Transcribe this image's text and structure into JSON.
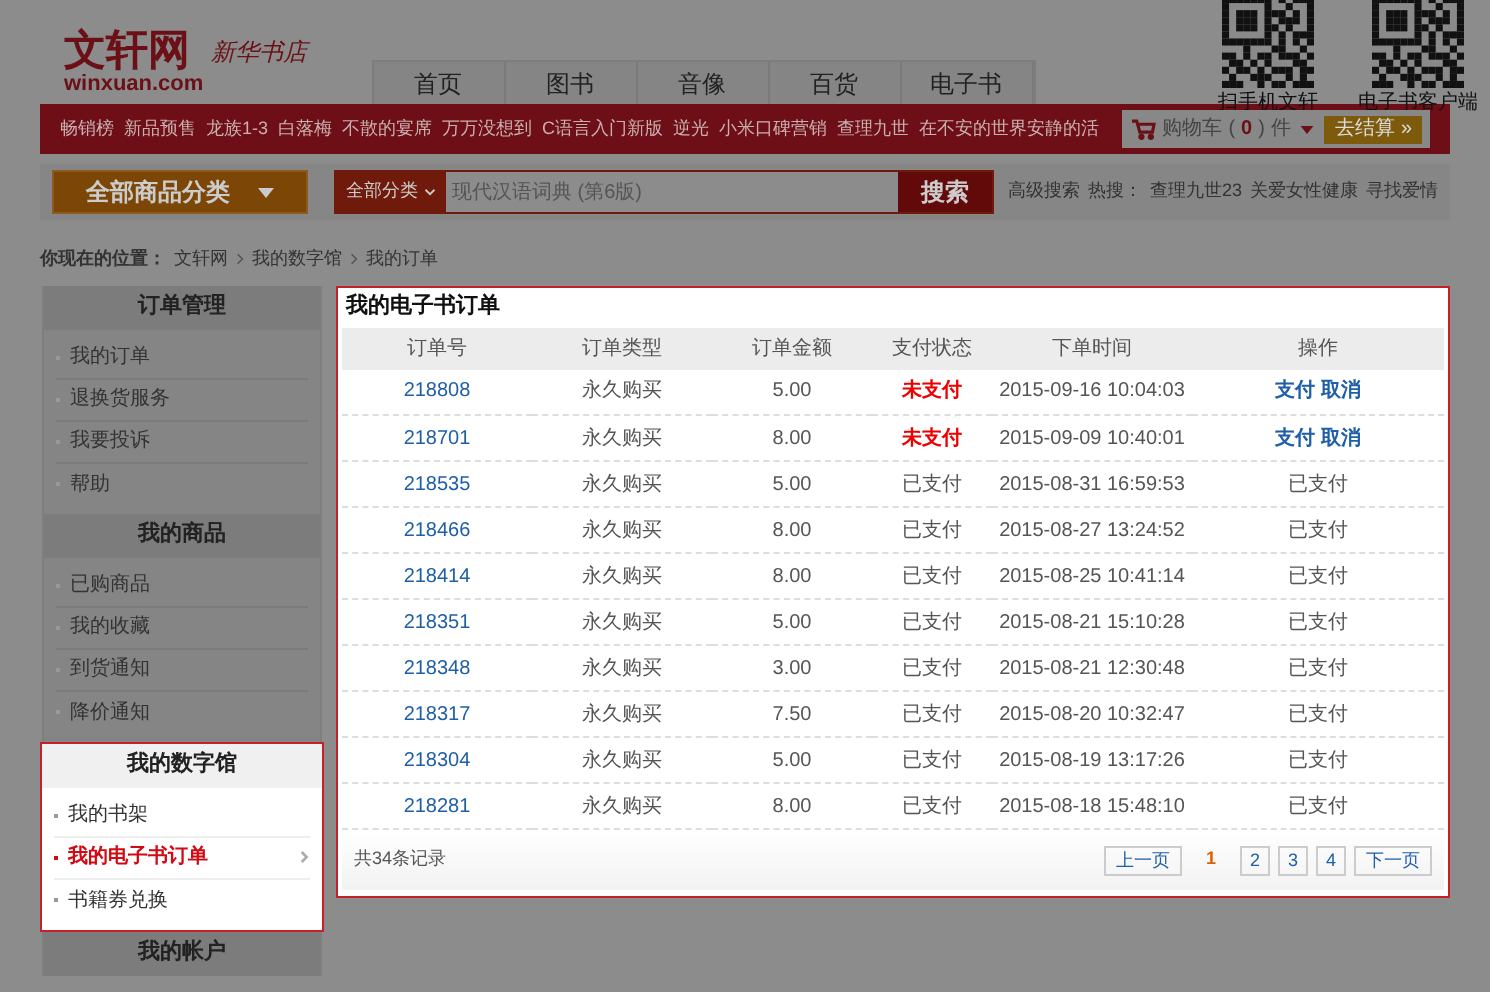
{
  "logo": {
    "name": "文轩网",
    "domain": "winxuan.com",
    "slogan": "新华书店"
  },
  "nav": [
    {
      "label": "首页"
    },
    {
      "label": "图书"
    },
    {
      "label": "音像"
    },
    {
      "label": "百货"
    },
    {
      "label": "电子书"
    }
  ],
  "qr_codes": [
    {
      "caption": "扫手机文轩"
    },
    {
      "caption": "电子书客户端"
    }
  ],
  "promo_links": [
    "畅销榜",
    "新品预售",
    "龙族1-3",
    "白落梅",
    "不散的宴席",
    "万万没想到",
    "C语言入门新版",
    "逆光",
    "小米口碑营销",
    "查理九世",
    "在不安的世界安静的活"
  ],
  "cart": {
    "label": "购物车",
    "open": "(",
    "count": "0",
    "close": ")",
    "unit": "件",
    "checkout": "去结算",
    "checkout_arrows": "»"
  },
  "category_button": "全部商品分类",
  "search": {
    "scope": "全部分类",
    "placeholder": "现代汉语词典 (第6版)",
    "button": "搜索",
    "advanced": "高级搜索",
    "hot_label": "热搜：",
    "hot": [
      "查理九世23",
      "关爱女性健康",
      "寻找爱情"
    ]
  },
  "breadcrumb": {
    "label": "你现在的位置：",
    "items": [
      "文轩网",
      "我的数字馆",
      "我的订单"
    ]
  },
  "sidebar": [
    {
      "title": "订单管理",
      "highlighted": false,
      "items": [
        {
          "label": "我的订单",
          "selected": false
        },
        {
          "label": "退换货服务",
          "selected": false
        },
        {
          "label": "我要投诉",
          "selected": false
        },
        {
          "label": "帮助",
          "selected": false
        }
      ]
    },
    {
      "title": "我的商品",
      "highlighted": false,
      "items": [
        {
          "label": "已购商品",
          "selected": false
        },
        {
          "label": "我的收藏",
          "selected": false
        },
        {
          "label": "到货通知",
          "selected": false
        },
        {
          "label": "降价通知",
          "selected": false
        }
      ]
    },
    {
      "title": "我的数字馆",
      "highlighted": true,
      "items": [
        {
          "label": "我的书架",
          "selected": false
        },
        {
          "label": "我的电子书订单",
          "selected": true
        },
        {
          "label": "书籍券兑换",
          "selected": false
        }
      ]
    },
    {
      "title": "我的帐户",
      "highlighted": false
    }
  ],
  "orders": {
    "title": "我的电子书订单",
    "columns": [
      "订单号",
      "订单类型",
      "订单金额",
      "支付状态",
      "下单时间",
      "操作"
    ],
    "rows": [
      {
        "id": "218808",
        "type": "永久购买",
        "amount": "5.00",
        "status": "未支付",
        "paid": false,
        "time": "2015-09-16 10:04:03",
        "actions": [
          "支付",
          "取消"
        ]
      },
      {
        "id": "218701",
        "type": "永久购买",
        "amount": "8.00",
        "status": "未支付",
        "paid": false,
        "time": "2015-09-09 10:40:01",
        "actions": [
          "支付",
          "取消"
        ]
      },
      {
        "id": "218535",
        "type": "永久购买",
        "amount": "5.00",
        "status": "已支付",
        "paid": true,
        "time": "2015-08-31 16:59:53",
        "action_text": "已支付"
      },
      {
        "id": "218466",
        "type": "永久购买",
        "amount": "8.00",
        "status": "已支付",
        "paid": true,
        "time": "2015-08-27 13:24:52",
        "action_text": "已支付"
      },
      {
        "id": "218414",
        "type": "永久购买",
        "amount": "8.00",
        "status": "已支付",
        "paid": true,
        "time": "2015-08-25 10:41:14",
        "action_text": "已支付"
      },
      {
        "id": "218351",
        "type": "永久购买",
        "amount": "5.00",
        "status": "已支付",
        "paid": true,
        "time": "2015-08-21 15:10:28",
        "action_text": "已支付"
      },
      {
        "id": "218348",
        "type": "永久购买",
        "amount": "3.00",
        "status": "已支付",
        "paid": true,
        "time": "2015-08-21 12:30:48",
        "action_text": "已支付"
      },
      {
        "id": "218317",
        "type": "永久购买",
        "amount": "7.50",
        "status": "已支付",
        "paid": true,
        "time": "2015-08-20 10:32:47",
        "action_text": "已支付"
      },
      {
        "id": "218304",
        "type": "永久购买",
        "amount": "5.00",
        "status": "已支付",
        "paid": true,
        "time": "2015-08-19 13:17:26",
        "action_text": "已支付"
      },
      {
        "id": "218281",
        "type": "永久购买",
        "amount": "8.00",
        "status": "已支付",
        "paid": true,
        "time": "2015-08-18 15:48:10",
        "action_text": "已支付"
      }
    ],
    "total": "共34条记录",
    "pagination": {
      "prev": "上一页",
      "next": "下一页",
      "pages": [
        {
          "label": "1",
          "selected": true
        },
        {
          "label": "2",
          "selected": false
        },
        {
          "label": "3",
          "selected": false
        },
        {
          "label": "4",
          "selected": false
        }
      ]
    }
  }
}
